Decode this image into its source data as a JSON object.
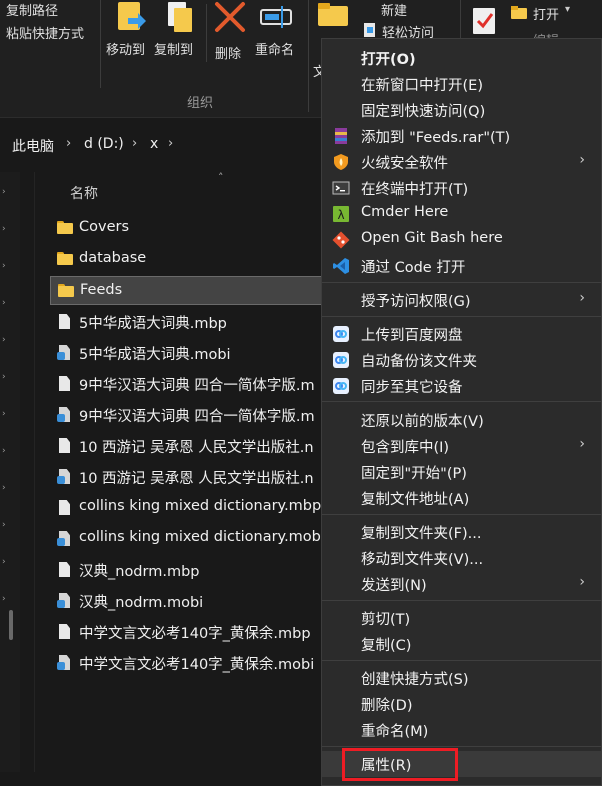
{
  "ribbon": {
    "clipboard_items": [
      "复制路径",
      "粘贴快捷方式"
    ],
    "organize_buttons": [
      {
        "label": "移动到",
        "icon": "move-to-icon"
      },
      {
        "label": "复制到",
        "icon": "copy-to-icon"
      },
      {
        "label": "删除",
        "icon": "delete-icon"
      },
      {
        "label": "重命名",
        "icon": "rename-icon"
      }
    ],
    "organize_group_label": "组织",
    "new_items": [
      "新建",
      "轻松访问"
    ],
    "new_group_partial": "文",
    "open_label": "打开",
    "edit_label": "编辑"
  },
  "breadcrumb": [
    "此电脑",
    "d (D:)",
    "x"
  ],
  "list": {
    "column_name": "名称",
    "items": [
      {
        "name": "Covers",
        "type": "folder"
      },
      {
        "name": "database",
        "type": "folder"
      },
      {
        "name": "Feeds",
        "type": "folder",
        "selected": true
      },
      {
        "name": "5中华成语大词典.mbp",
        "type": "doc"
      },
      {
        "name": "5中华成语大词典.mobi",
        "type": "mobi"
      },
      {
        "name": "9中华汉语大词典 四合一简体字版.m",
        "type": "doc"
      },
      {
        "name": "9中华汉语大词典 四合一简体字版.m",
        "type": "mobi"
      },
      {
        "name": "10 西游记  吴承恩 人民文学出版社.n",
        "type": "doc"
      },
      {
        "name": "10 西游记  吴承恩 人民文学出版社.n",
        "type": "mobi"
      },
      {
        "name": "collins king mixed dictionary.mbp",
        "type": "doc"
      },
      {
        "name": "collins king mixed dictionary.mob",
        "type": "mobi"
      },
      {
        "name": "汉典_nodrm.mbp",
        "type": "doc"
      },
      {
        "name": "汉典_nodrm.mobi",
        "type": "mobi"
      },
      {
        "name": "中学文言文必考140字_黄保余.mbp",
        "type": "doc"
      },
      {
        "name": "中学文言文必考140字_黄保余.mobi",
        "type": "mobi"
      }
    ]
  },
  "context_menu": {
    "items": [
      {
        "label": "打开(O)",
        "bold": true
      },
      {
        "label": "在新窗口中打开(E)"
      },
      {
        "label": "固定到快速访问(Q)"
      },
      {
        "label": "添加到 \"Feeds.rar\"(T)",
        "icon": "winrar-icon"
      },
      {
        "label": "火绒安全软件",
        "icon": "huorong-shield-icon",
        "submenu": true
      },
      {
        "label": "在终端中打开(T)",
        "icon": "terminal-icon"
      },
      {
        "label": "Cmder Here",
        "icon": "cmder-lambda-icon"
      },
      {
        "label": "Open Git Bash here",
        "icon": "git-icon"
      },
      {
        "label": "通过 Code 打开",
        "icon": "vscode-icon"
      },
      {
        "label": "授予访问权限(G)",
        "submenu": true
      },
      {
        "label": "上传到百度网盘",
        "icon": "baidu-netdisk-icon"
      },
      {
        "label": "自动备份该文件夹",
        "icon": "baidu-netdisk-icon"
      },
      {
        "label": "同步至其它设备",
        "icon": "baidu-netdisk-icon"
      },
      {
        "label": "还原以前的版本(V)"
      },
      {
        "label": "包含到库中(I)",
        "submenu": true
      },
      {
        "label": "固定到\"开始\"(P)"
      },
      {
        "label": "复制文件地址(A)"
      },
      {
        "label": "复制到文件夹(F)..."
      },
      {
        "label": "移动到文件夹(V)..."
      },
      {
        "label": "发送到(N)",
        "submenu": true
      },
      {
        "label": "剪切(T)"
      },
      {
        "label": "复制(C)"
      },
      {
        "label": "创建快捷方式(S)"
      },
      {
        "label": "删除(D)"
      },
      {
        "label": "重命名(M)"
      },
      {
        "label": "属性(R)",
        "highlighted": true
      }
    ],
    "submenu_arrow": "›"
  },
  "colors": {
    "highlight_box": "#ee1c24",
    "folder": "#f5c94c",
    "menu_bg": "#2b2b2b"
  }
}
